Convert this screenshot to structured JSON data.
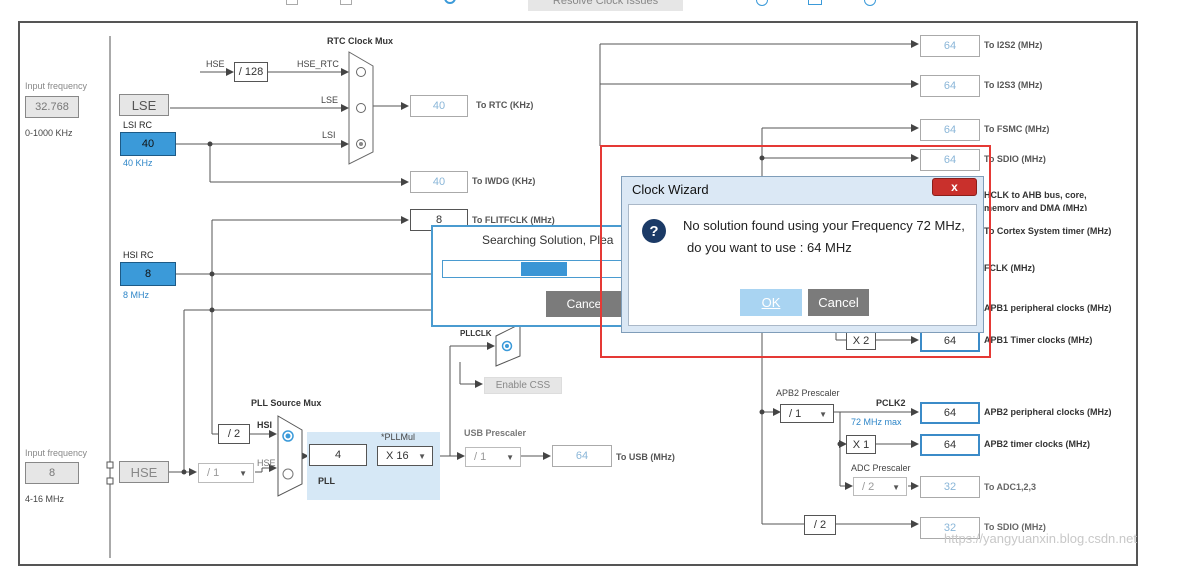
{
  "toolbar": {
    "resolve_label": "Resolve Clock Issues"
  },
  "lse_section": {
    "input_freq_label": "Input frequency",
    "input_freq_value": "32.768",
    "input_range": "0-1000 KHz",
    "lse_label": "LSE",
    "lsi_rc_label": "LSI RC",
    "lsi_value": "40",
    "lsi_freq": "40 KHz"
  },
  "rtc_mux": {
    "title": "RTC Clock Mux",
    "hse_label": "HSE",
    "div128": "/ 128",
    "hse_rtc": "HSE_RTC",
    "lse_in": "LSE",
    "lsi_in": "LSI",
    "rtc_value": "40",
    "rtc_label": "To RTC (KHz)",
    "iwdg_value": "40",
    "iwdg_label": "To IWDG (KHz)",
    "flitf_value": "8",
    "flitf_label": "To FLITFCLK (MHz)"
  },
  "hsi_section": {
    "hsi_rc_label": "HSI RC",
    "hsi_value": "8",
    "hsi_freq": "8 MHz"
  },
  "hse_section": {
    "input_freq_label": "Input frequency",
    "input_freq_value": "8",
    "input_range": "4-16 MHz",
    "hse_label": "HSE"
  },
  "pll": {
    "source_mux_title": "PLL Source Mux",
    "div2": "/ 2",
    "hsi_in": "HSI",
    "hse_in": "HSE",
    "prediv": "/ 1",
    "value": "4",
    "pllmul_label": "*PLLMul",
    "pllmul_value": "X 16",
    "pll_label": "PLL",
    "pllclk_label": "PLLCLK",
    "enable_css": "Enable CSS"
  },
  "usb": {
    "prescaler_label": "USB Prescaler",
    "prescaler_value": "/ 1",
    "value": "64",
    "label": "To USB (MHz)"
  },
  "outputs": {
    "i2s2_value": "64",
    "i2s2_label": "To I2S2 (MHz)",
    "i2s3_value": "64",
    "i2s3_label": "To I2S3 (MHz)",
    "fsmc_value": "64",
    "fsmc_label": "To FSMC (MHz)",
    "sdio_value": "64",
    "sdio_label": "To SDIO (MHz)",
    "hclk_label_1": "HCLK to AHB bus, core,",
    "hclk_label_2": "memory and DMA (MHz)",
    "cortex_label": "To Cortex System timer (MHz)",
    "fclk_label": "FCLK (MHz)",
    "apb1_periph_label": "APB1 peripheral clocks (MHz)",
    "apb1_timer_mul": "X 2",
    "apb1_timer_value": "64",
    "apb1_timer_label": "APB1 Timer clocks (MHz)",
    "apb2_prescaler_label": "APB2 Prescaler",
    "apb2_prescaler_value": "/ 1",
    "pclk2_label": "PCLK2",
    "pclk2_max": "72 MHz max",
    "apb2_periph_value": "64",
    "apb2_periph_label": "APB2 peripheral clocks (MHz)",
    "apb2_timer_mul": "X 1",
    "apb2_timer_value": "64",
    "apb2_timer_label": "APB2 timer clocks (MHz)",
    "adc_prescaler_label": "ADC Prescaler",
    "adc_prescaler_value": "/ 2",
    "adc_value": "32",
    "adc_label": "To ADC1,2,3",
    "sdio2_div": "/ 2",
    "sdio2_value": "32",
    "sdio2_label": "To SDIO (MHz)"
  },
  "progress_dialog": {
    "text": "Searching Solution, Plea",
    "cancel_label": "Cance",
    "progress": 0.65
  },
  "wizard": {
    "title": "Clock Wizard",
    "close_glyph": "x",
    "message_line1": "No solution found using your Frequency 72 MHz,",
    "message_line2": "do you want to use :  64 MHz",
    "ok_label": "OK",
    "cancel_label": "Cancel"
  },
  "watermark": "https://yangyuanxin.blog.csdn.net",
  "colors": {
    "accent": "#3b9ad9",
    "highlight_border": "#e53935",
    "wizard_title_bg": "#dbe8f5",
    "close_red": "#c9302c"
  }
}
